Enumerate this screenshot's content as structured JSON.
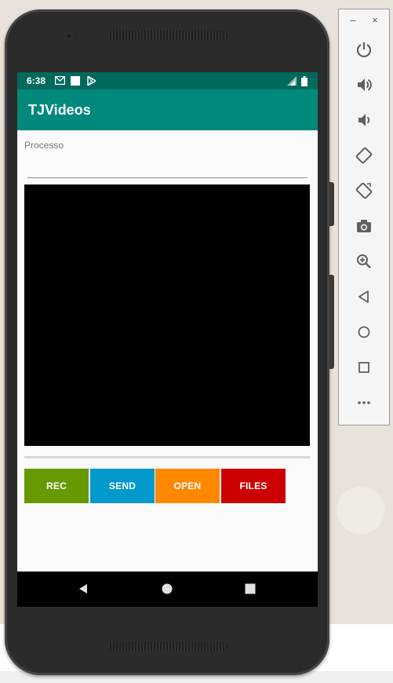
{
  "status_bar": {
    "time": "6:38",
    "icons": [
      "gmail-icon",
      "square-notification-icon",
      "play-store-icon",
      "signal-icon",
      "battery-icon"
    ]
  },
  "app_bar": {
    "title": "TJVideos"
  },
  "main": {
    "process_label": "Processo",
    "process_value": "",
    "buttons": {
      "rec": "REC",
      "send": "SEND",
      "open": "OPEN",
      "files": "FILES"
    }
  },
  "nav_bar": {
    "buttons": [
      "back-icon",
      "home-icon",
      "recents-icon"
    ]
  },
  "emulator_toolbar": {
    "minimize": "–",
    "close": "×",
    "items": [
      "power-icon",
      "volume-up-icon",
      "volume-down-icon",
      "rotate-left-icon",
      "rotate-right-icon",
      "camera-icon",
      "zoom-icon",
      "back-icon",
      "home-icon",
      "overview-icon",
      "more-icon"
    ]
  },
  "colors": {
    "status_bar": "#00695c",
    "app_bar": "#00897b",
    "rec": "#669900",
    "send": "#0099cc",
    "open": "#ff8800",
    "files": "#cc0000"
  }
}
